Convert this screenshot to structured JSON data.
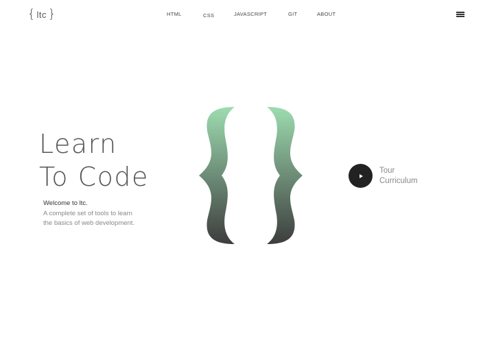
{
  "logo": {
    "open_brace": "{",
    "text": "ltc",
    "close_brace": "}"
  },
  "nav": {
    "items": [
      {
        "label": "HTML"
      },
      {
        "label": "CSS"
      },
      {
        "label": "JAVASCRIPT"
      },
      {
        "label": "GIT"
      },
      {
        "label": "ABOUT"
      }
    ]
  },
  "menu": {
    "icon": "hamburger-icon"
  },
  "hero": {
    "title_line1": "Learn",
    "title_line2": "To Code",
    "welcome": "Welcome to ltc.",
    "description_line1": "A complete set of tools to learn",
    "description_line2": "the basics of web development.",
    "graphic_icon": "curly-braces-icon",
    "gradient_top": "#9ddcb0",
    "gradient_bottom": "#3d3d3d"
  },
  "tour": {
    "icon": "play-icon",
    "label_line1": "Tour",
    "label_line2": "Curriculum"
  }
}
